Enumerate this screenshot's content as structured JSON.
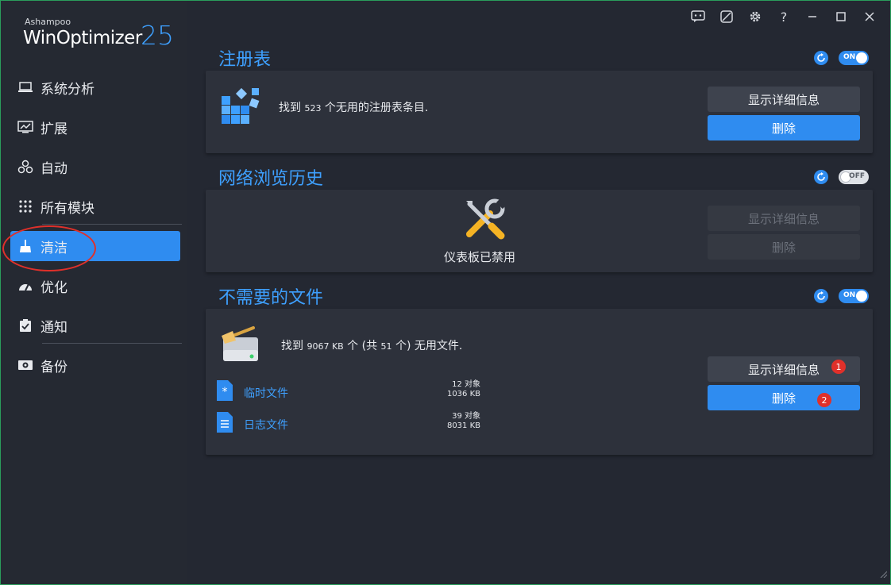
{
  "app": {
    "brand_small": "Ashampoo",
    "brand_name": "WinOptimizer",
    "brand_version": "25"
  },
  "titlebar": {
    "help_label": "?"
  },
  "sidebar": {
    "items": [
      {
        "label": "系统分析",
        "icon": "laptop-icon"
      },
      {
        "label": "扩展",
        "icon": "chart-icon"
      },
      {
        "label": "自动",
        "icon": "link-icon"
      },
      {
        "label": "所有模块",
        "icon": "grid-icon"
      },
      {
        "label": "清洁",
        "icon": "broom-icon",
        "active": true
      },
      {
        "label": "优化",
        "icon": "gauge-icon"
      },
      {
        "label": "通知",
        "icon": "clipboard-icon"
      },
      {
        "label": "备份",
        "icon": "backup-icon"
      }
    ]
  },
  "sections": {
    "registry": {
      "title": "注册表",
      "toggle": "ON",
      "text_prefix": "找到",
      "text_count": "523",
      "text_suffix": "个无用的注册表条目.",
      "details_label": "显示详细信息",
      "delete_label": "删除"
    },
    "browser": {
      "title": "网络浏览历史",
      "toggle": "OFF",
      "disabled_text": "仪表板已禁用",
      "details_label": "显示详细信息",
      "delete_label": "删除"
    },
    "files": {
      "title": "不需要的文件",
      "toggle": "ON",
      "text_prefix": "找到",
      "text_size": "9067 KB",
      "text_mid": "个 (共",
      "text_count": "51",
      "text_suffix": "个) 无用文件.",
      "details_label": "显示详细信息",
      "delete_label": "删除",
      "badge1": "1",
      "badge2": "2",
      "rows": [
        {
          "label": "临时文件",
          "objects": "12 对象",
          "size": "1036 KB"
        },
        {
          "label": "日志文件",
          "objects": "39 对象",
          "size": "8031 KB"
        }
      ]
    }
  },
  "colors": {
    "accent": "#2f8cf0",
    "title_blue": "#3ea0ff",
    "annotation_red": "#e0302a"
  }
}
